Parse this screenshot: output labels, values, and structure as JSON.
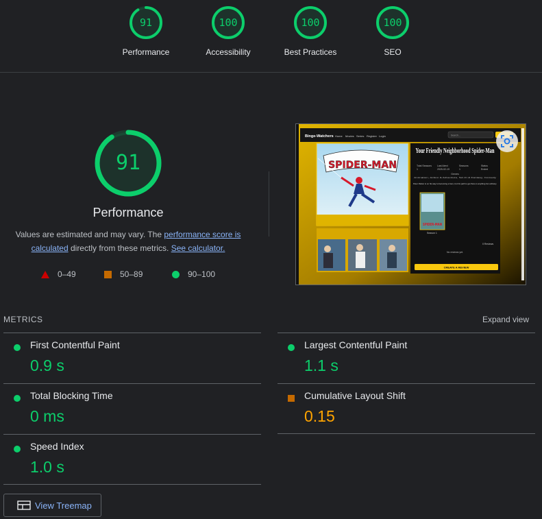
{
  "gauges": [
    {
      "score": 91,
      "score_text": "91",
      "label": "Performance"
    },
    {
      "score": 100,
      "score_text": "100",
      "label": "Accessibility"
    },
    {
      "score": 100,
      "score_text": "100",
      "label": "Best Practices"
    },
    {
      "score": 100,
      "score_text": "100",
      "label": "SEO"
    }
  ],
  "performance": {
    "score": 91,
    "score_text": "91",
    "title": "Performance",
    "desc_prefix": "Values are estimated and may vary. The ",
    "link_score": "performance score is calculated",
    "desc_mid": " directly from these metrics. ",
    "link_calc": "See calculator.",
    "legend": [
      "0–49",
      "50–89",
      "90–100"
    ]
  },
  "screenshot": {
    "brand": "Binge-Watchers",
    "nav": [
      "Home",
      "Movies",
      "Series",
      "Register",
      "Login"
    ],
    "search_placeholder": "Search...",
    "poster_title": "SPIDER-MAN",
    "title": "Your Friendly Neighborhood Spider-Man",
    "info_labels": [
      "Total Seasons",
      "Last Aired",
      "Seasons",
      "Status"
    ],
    "info_values": [
      "1",
      "2025-02-19",
      "1",
      "Ended"
    ],
    "genres_label": "Genres",
    "genres": "Animation, Action & Adventure, Sci-Fi & Fantasy, Comedy",
    "overview": "Peter Parker is on his way to becoming a hero, but his path to get there is anything but ordinary.",
    "season_label": "Season 1",
    "reviews_count": "0 Reviews",
    "no_reviews": "No reviews yet.",
    "review_button": "CREATE A REVIEW"
  },
  "metrics": {
    "header": "METRICS",
    "expand": "Expand view",
    "items": [
      {
        "name": "First Contentful Paint",
        "value": "0.9 s",
        "status": "good"
      },
      {
        "name": "Largest Contentful Paint",
        "value": "1.1 s",
        "status": "good"
      },
      {
        "name": "Total Blocking Time",
        "value": "0 ms",
        "status": "good"
      },
      {
        "name": "Cumulative Layout Shift",
        "value": "0.15",
        "status": "average"
      },
      {
        "name": "Speed Index",
        "value": "1.0 s",
        "status": "good"
      }
    ]
  },
  "treemap_button": "View Treemap",
  "colors": {
    "good": "#0cce6b",
    "average": "#ffa400",
    "poor": "#ff4e42",
    "accent": "#f9c80e"
  }
}
